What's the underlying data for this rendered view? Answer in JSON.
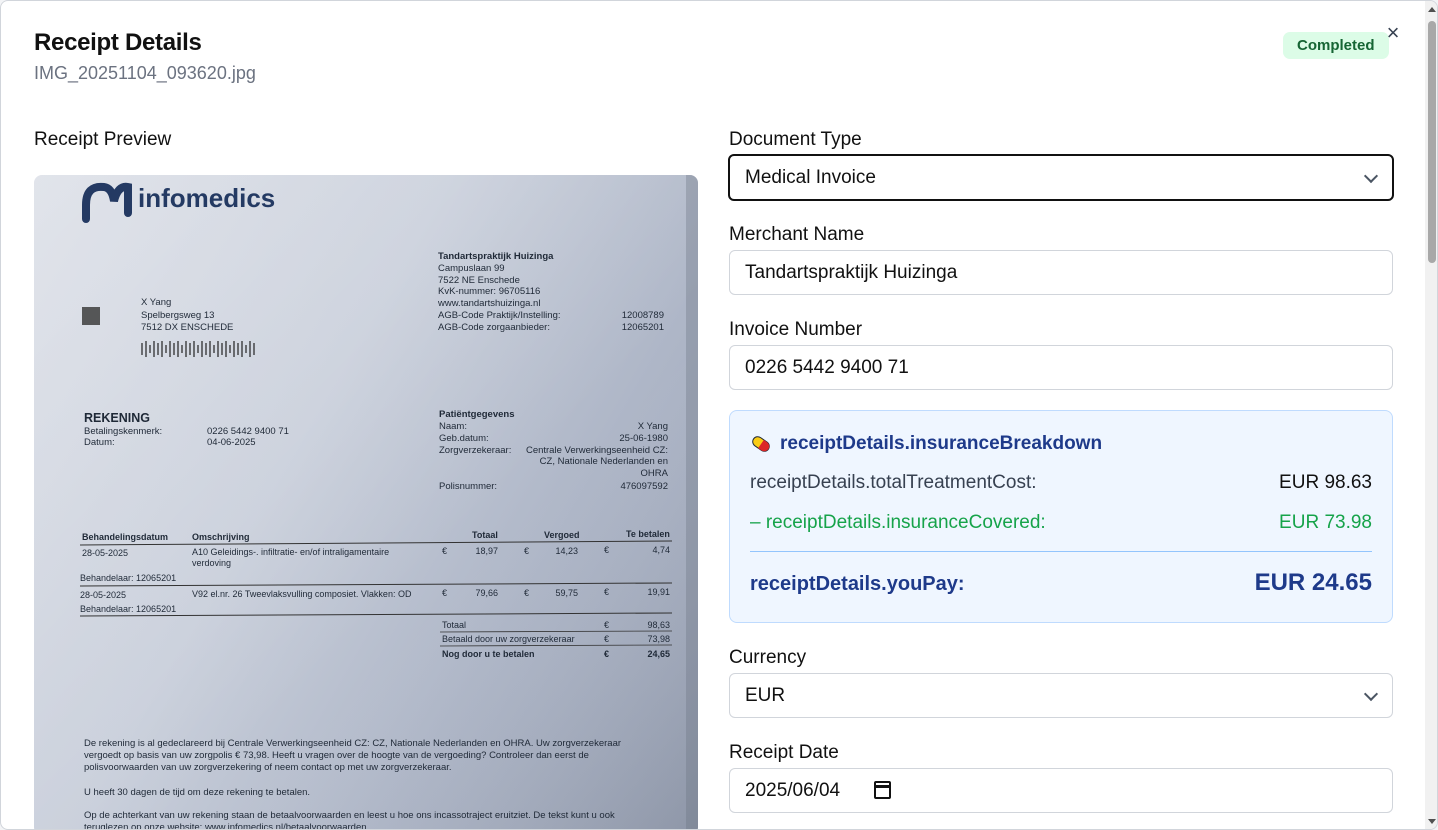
{
  "header": {
    "title": "Receipt Details",
    "filename": "IMG_20251104_093620.jpg",
    "status": "Completed",
    "close_icon": "×"
  },
  "preview": {
    "label": "Receipt Preview",
    "doc": {
      "brand": "infomedics",
      "provider_name": "Tandartspraktijk Huizinga",
      "provider_lines": [
        "Campuslaan 99",
        "7522 NE  Enschede",
        "KvK-nummer: 96705116",
        "www.tandartshuizinga.nl"
      ],
      "agb1_label": "AGB-Code Praktijk/Instelling:",
      "agb1_value": "12008789",
      "agb2_label": "AGB-Code zorgaanbieder:",
      "agb2_value": "12065201",
      "patient_lines": [
        "X Yang",
        "Spelbergsweg 13",
        "7512 DX  ENSCHEDE"
      ],
      "rekening": "REKENING",
      "betaling_label": "Betalingskenmerk:",
      "betaling_value": "0226 5442 9400 71",
      "datum_label": "Datum:",
      "datum_value": "04-06-2025",
      "pg_title": "Patiëntgegevens",
      "pg_naam_label": "Naam:",
      "pg_naam": "X Yang",
      "pg_geb_label": "Geb.datum:",
      "pg_geb": "25-06-1980",
      "pg_zv_label": "Zorgverzekeraar:",
      "pg_zv1": "Centrale Verwerkingseenheid CZ:",
      "pg_zv2": "CZ,  Nationale Nederlanden en",
      "pg_zv3": "OHRA",
      "pg_polis_label": "Polisnummer:",
      "pg_polis": "476097592",
      "th_datum": "Behandelingsdatum",
      "th_omschrijving": "Omschrijving",
      "th_totaal": "Totaal",
      "th_vergoed": "Vergoed",
      "th_tebetalen": "Te betalen",
      "row1_date": "28-05-2025",
      "row1_desc1": "A10 Geleidings-. infiltratie- en/of intraligamentaire",
      "row1_desc2": "verdoving",
      "row1_totaal": "18,97",
      "row1_vergoed": "14,23",
      "row1_betalen": "4,74",
      "behandelaar": "Behandelaar: 12065201",
      "row2_date": "28-05-2025",
      "row2_desc": "V92 el.nr. 26 Tweevlaksvulling composiet. Vlakken: OD",
      "row2_totaal": "79,66",
      "row2_vergoed": "59,75",
      "row2_betalen": "19,91",
      "euro": "€",
      "sum_totaal_label": "Totaal",
      "sum_totaal": "98,63",
      "sum_betaald_label": "Betaald door uw zorgverzekeraar",
      "sum_betaald": "73,98",
      "sum_nog_label": "Nog door u te betalen",
      "sum_nog": "24,65",
      "footer_lines": [
        "De rekening is al gedeclareerd bij Centrale Verwerkingseenheid CZ: CZ,  Nationale Nederlanden en OHRA. Uw zorgverzekeraar",
        "vergoedt op basis van uw zorgpolis € 73,98. Heeft u vragen over de hoogte van de vergoeding? Controleer dan eerst de",
        "polisvoorwaarden van uw zorgverzekering of neem contact op met uw zorgverzekeraar.",
        "U heeft 30 dagen de tijd om deze rekening te betalen.",
        "Op de achterkant van uw rekening staan de betaalvoorwaarden en leest u hoe ons incassotraject eruitziet. De tekst kunt u ook",
        "teruglezen op onze website: www.infomedics.nl/betaalvoorwaarden."
      ]
    }
  },
  "form": {
    "document_type_label": "Document Type",
    "document_type_value": "Medical Invoice",
    "merchant_label": "Merchant Name",
    "merchant_value": "Tandartspraktijk Huizinga",
    "invoice_label": "Invoice Number",
    "invoice_value": "0226 5442 9400 71",
    "currency_label": "Currency",
    "currency_value": "EUR",
    "date_label": "Receipt Date",
    "date_value": "2025/06/04"
  },
  "insurance": {
    "title": "receiptDetails.insuranceBreakdown",
    "total_label": "receiptDetails.totalTreatmentCost:",
    "total_value": "EUR 98.63",
    "covered_label": "– receiptDetails.insuranceCovered:",
    "covered_value": "EUR 73.98",
    "pay_label": "receiptDetails.youPay:",
    "pay_value": "EUR 24.65"
  },
  "colors": {
    "accent_blue": "#1e3a8a",
    "success_green": "#16a34a",
    "badge_bg": "#dcfce7"
  },
  "icons": {
    "close": "close-icon",
    "pill": "pill-icon",
    "chevron": "chevron-down-icon",
    "calendar": "calendar-icon"
  }
}
